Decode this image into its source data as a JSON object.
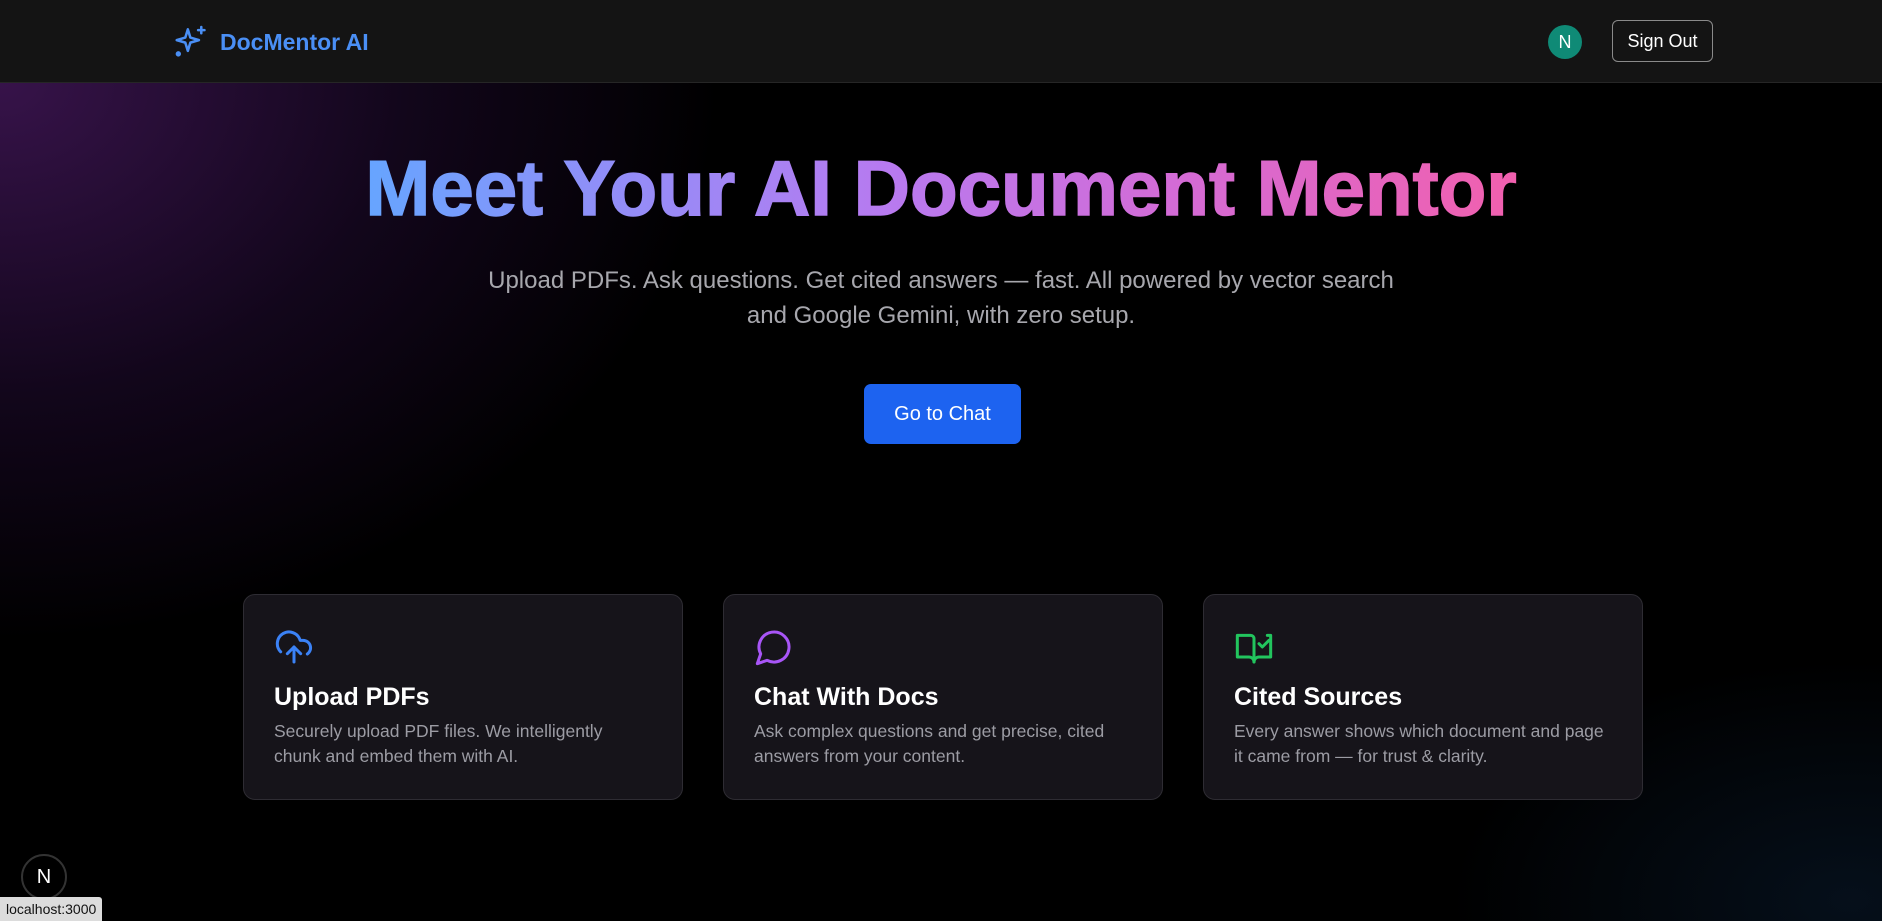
{
  "header": {
    "brand_name": "DocMentor AI",
    "avatar_initial": "N",
    "sign_out_label": "Sign Out"
  },
  "hero": {
    "title": "Meet Your AI Document Mentor",
    "subtitle_line1": "Upload PDFs. Ask questions. Get cited answers — fast. All powered by vector search",
    "subtitle_line2": "and Google Gemini, with zero setup.",
    "cta_label": "Go to Chat"
  },
  "features": [
    {
      "icon": "cloud-upload-icon",
      "title": "Upload PDFs",
      "desc_line1": "Securely upload PDF files. We intelligently",
      "desc_line2": "chunk and embed them with AI.",
      "color": "#3b82f6"
    },
    {
      "icon": "chat-bubble-icon",
      "title": "Chat With Docs",
      "desc_line1": "Ask complex questions and get precise, cited",
      "desc_line2": "answers from your content.",
      "color": "#a855f7"
    },
    {
      "icon": "book-check-icon",
      "title": "Cited Sources",
      "desc_line1": "Every answer shows which document and page",
      "desc_line2": "it came from — for trust & clarity.",
      "color": "#22c55e"
    }
  ],
  "dev_badge_letter": "N",
  "status_url": "localhost:3000",
  "colors": {
    "brand": "#4a8ff5",
    "cta": "#1d63f0",
    "avatar": "#0f8a76"
  }
}
